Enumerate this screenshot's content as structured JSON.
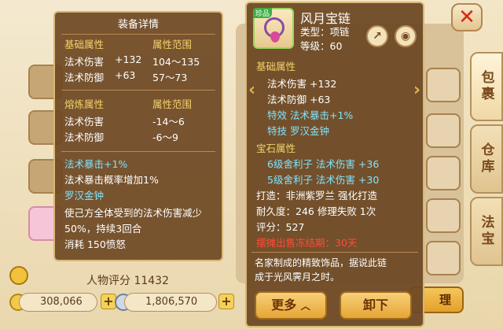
{
  "left_panel": {
    "title": "装备详情",
    "base_header": "基础属性",
    "range_header": "属性范围",
    "base_rows": [
      {
        "name": "法术伤害",
        "value": "+132",
        "range": "104～135"
      },
      {
        "name": "法术防御",
        "value": "+63",
        "range": "57～73"
      }
    ],
    "smelt_header": "熔炼属性",
    "smelt_range_header": "属性范围",
    "smelt_rows": [
      {
        "name": "法术伤害",
        "range": "-14～6"
      },
      {
        "name": "法术防御",
        "range": "-6～9"
      }
    ],
    "effect1": "法术暴击+1%",
    "effect1_desc": "法术暴击概率增加1%",
    "skill_name": "罗汉金钟",
    "skill_desc_line1": "使己方全体受到的法术伤害减少",
    "skill_desc_line2": "50%，持续3回合",
    "skill_cost": "消耗 150愤怒"
  },
  "item": {
    "badge": "珍品",
    "name": "风月宝链",
    "type": "类型：项链",
    "level": "等级：60",
    "base_header": "基础属性",
    "base_rows": [
      "法术伤害 +132",
      "法术防御 +63"
    ],
    "special_effect": "特效  法术暴击+1%",
    "special_skill": "特技  罗汉金钟",
    "gem_header": "宝石属性",
    "gem_rows": [
      "6级舍利子  法术伤害 +36",
      "5级舍利子  法术伤害 +30"
    ],
    "forge": "打造：非洲紫罗兰   强化打造",
    "durability": "耐久度：246  修理失败  1次",
    "score": "评分：527",
    "freeze_note": "摆摊出售冻结期：30天",
    "description_line1": "名家制成的精致饰品，据说此链",
    "description_line2": "成于光风霁月之时。",
    "more_button": "更多",
    "unequip_button": "卸下"
  },
  "side_tabs": [
    "包裹",
    "仓库",
    "法宝"
  ],
  "character_score_label": "人物评分",
  "character_score_value": "11432",
  "currency": {
    "gold": "308,066",
    "silver": "1,806,570"
  },
  "manage_button_fragment": "理",
  "icons": {
    "close": "close-icon",
    "share": "share-icon",
    "view": "eye-icon",
    "lock": "lock-icon"
  }
}
